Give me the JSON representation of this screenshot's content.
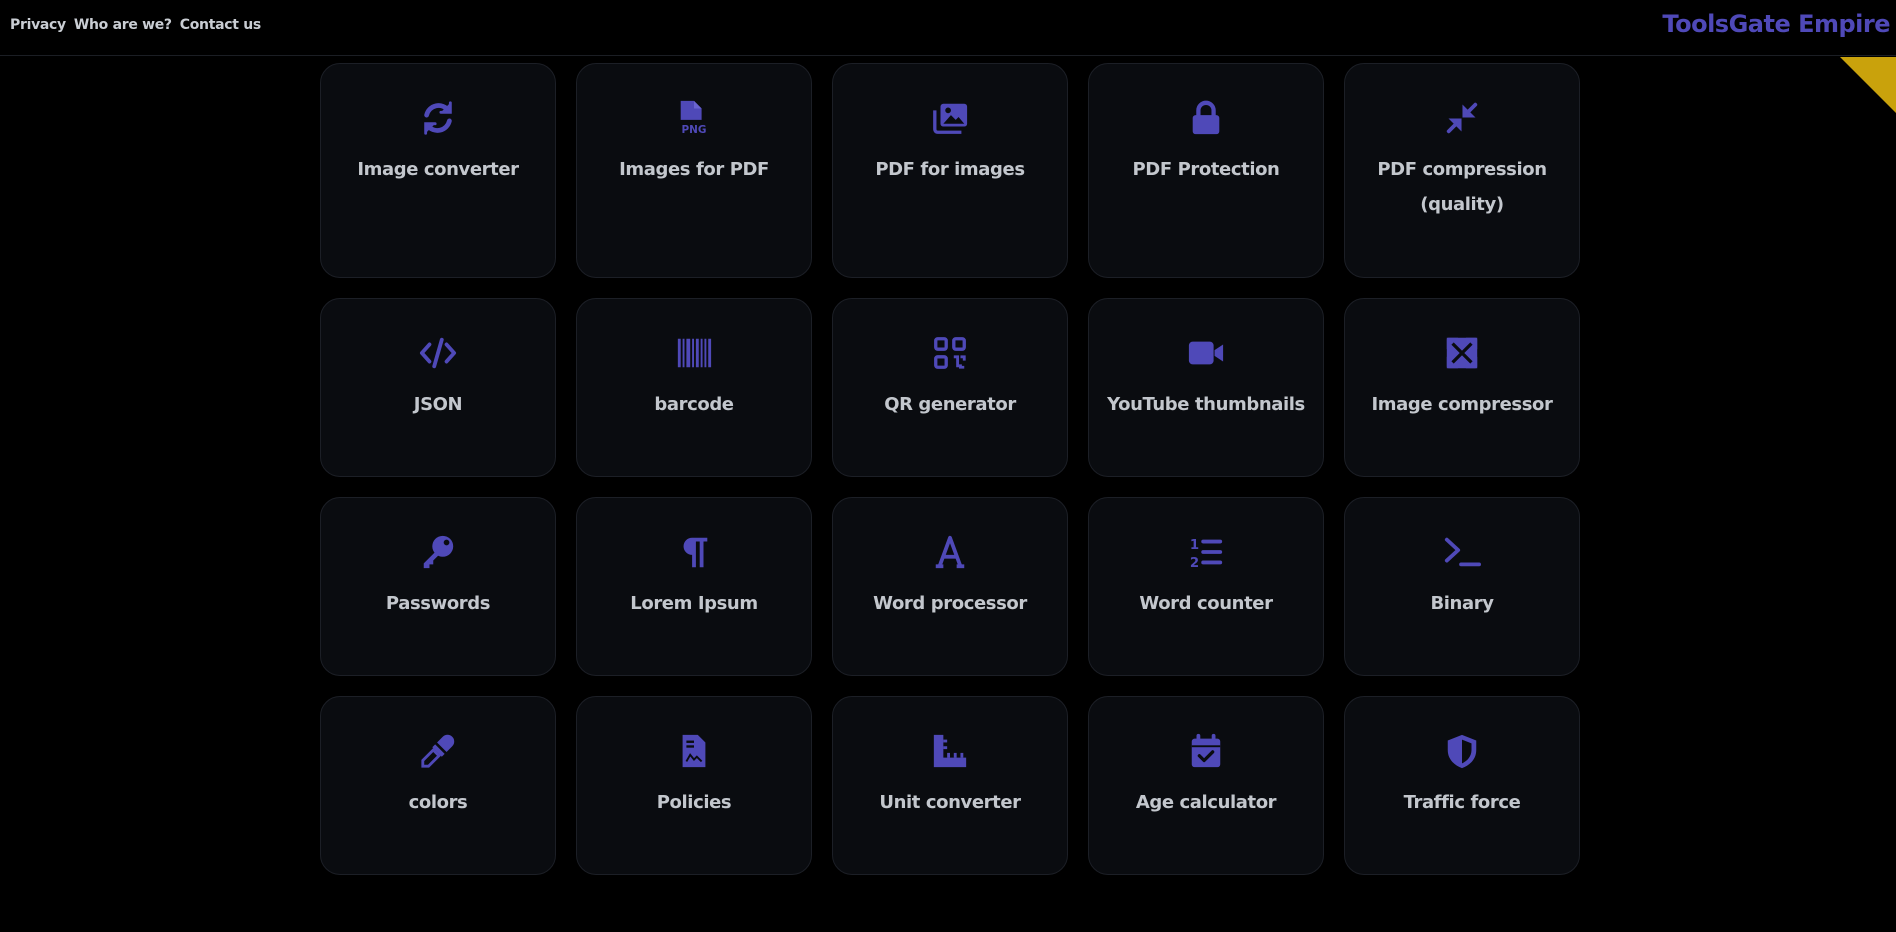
{
  "nav": {
    "links": [
      "Privacy",
      "Who are we?",
      "Contact us"
    ],
    "brand": "ToolsGate Empire"
  },
  "colors": {
    "accent": "#4f49b8",
    "corner": "#c9a20c",
    "card_bg": "#0a0c10",
    "text": "#c3c7cd"
  },
  "tools": [
    {
      "label": "Image converter",
      "icon": "sync-icon"
    },
    {
      "label": "Images for PDF",
      "icon": "png-file-icon"
    },
    {
      "label": "PDF for images",
      "icon": "images-icon"
    },
    {
      "label": "PDF Protection",
      "icon": "lock-icon"
    },
    {
      "label": "PDF compression (quality)",
      "icon": "compress-icon"
    },
    {
      "label": "JSON",
      "icon": "code-icon"
    },
    {
      "label": "barcode",
      "icon": "barcode-icon"
    },
    {
      "label": "QR generator",
      "icon": "qrcode-icon"
    },
    {
      "label": "YouTube thumbnails",
      "icon": "video-icon"
    },
    {
      "label": "Image compressor",
      "icon": "expand-arrows-icon"
    },
    {
      "label": "Passwords",
      "icon": "key-icon"
    },
    {
      "label": "Lorem Ipsum",
      "icon": "paragraph-icon"
    },
    {
      "label": "Word processor",
      "icon": "font-icon"
    },
    {
      "label": "Word counter",
      "icon": "list-ol-icon"
    },
    {
      "label": "Binary",
      "icon": "terminal-icon"
    },
    {
      "label": "colors",
      "icon": "eyedropper-icon"
    },
    {
      "label": "Policies",
      "icon": "file-invoice-icon"
    },
    {
      "label": "Unit converter",
      "icon": "ruler-icon"
    },
    {
      "label": "Age calculator",
      "icon": "calendar-check-icon"
    },
    {
      "label": "Traffic force",
      "icon": "shield-icon"
    }
  ]
}
